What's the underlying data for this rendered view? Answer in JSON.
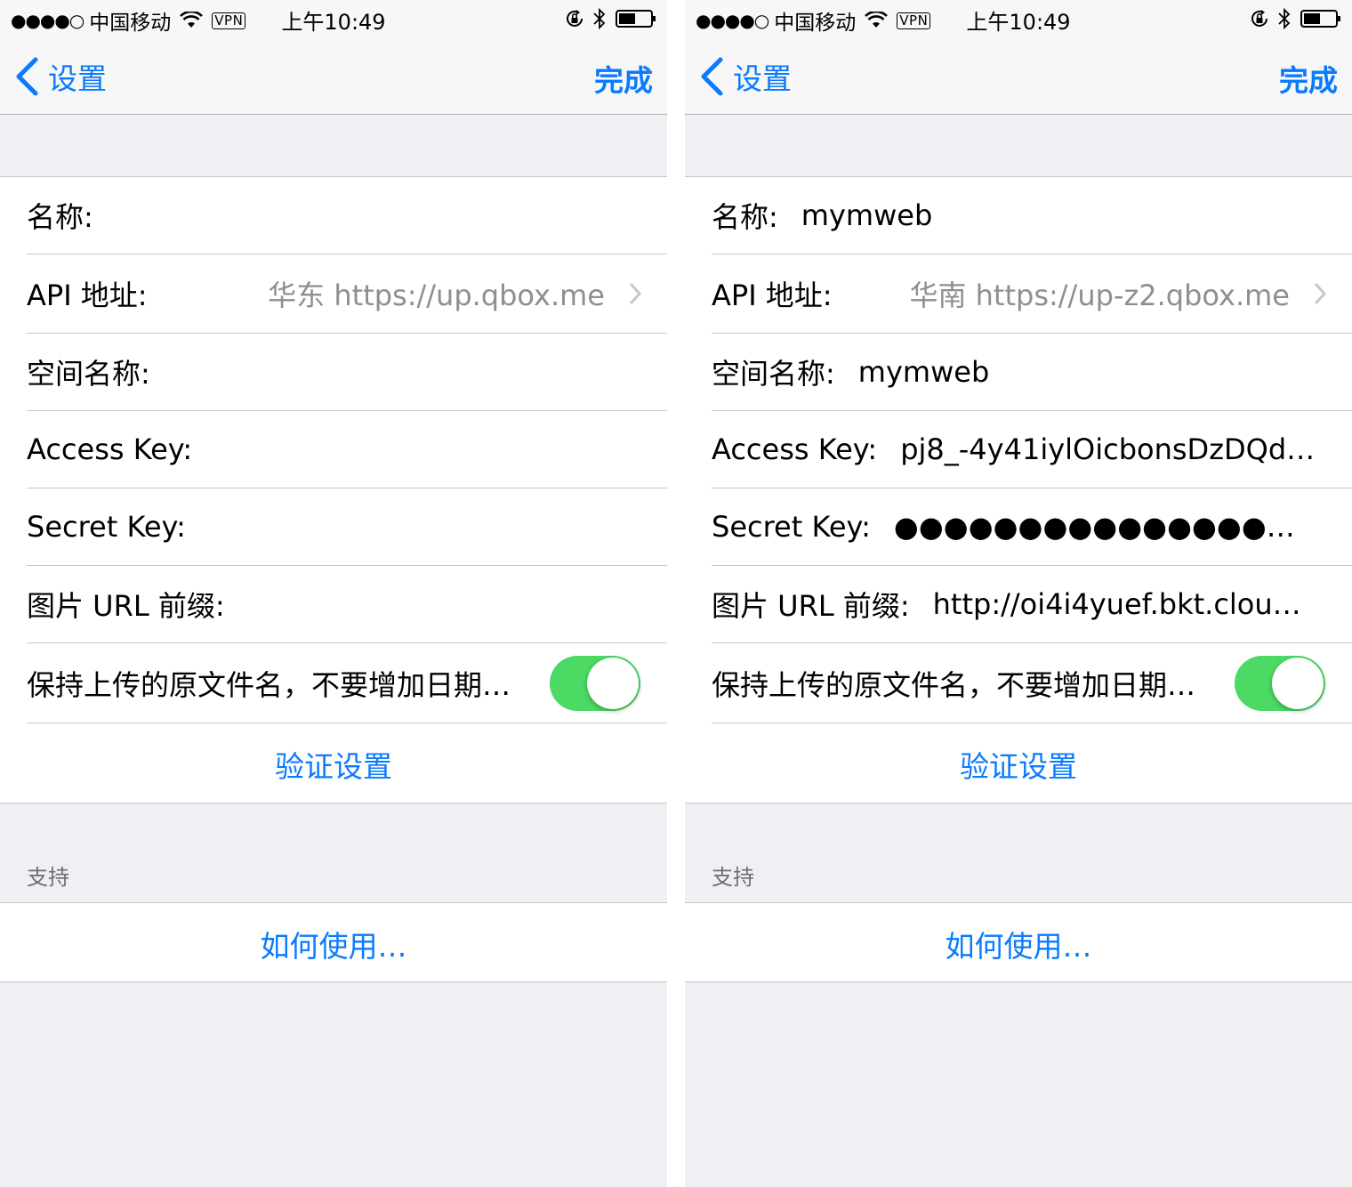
{
  "colors": {
    "accent": "#0a7aff",
    "toggle_on": "#4cd964",
    "background": "#efeff4"
  },
  "screens": [
    {
      "status": {
        "signal": "●●●●○",
        "carrier": "中国移动",
        "vpn": "VPN",
        "time": "上午10:49"
      },
      "nav": {
        "back": "设置",
        "done": "完成"
      },
      "form": {
        "name_label": "名称:",
        "name_value": "",
        "api_label": "API 地址:",
        "api_value": "华东 https://up.qbox.me",
        "bucket_label": "空间名称:",
        "bucket_value": "",
        "access_label": "Access Key:",
        "access_value": "",
        "secret_label": "Secret Key:",
        "secret_value": "",
        "prefix_label": "图片 URL 前缀:",
        "prefix_value": "",
        "keep_name_label": "保持上传的原文件名，不要增加日期…",
        "keep_name_on": true,
        "verify": "验证设置"
      },
      "support": {
        "header": "支持",
        "how_to": "如何使用…"
      }
    },
    {
      "status": {
        "signal": "●●●●○",
        "carrier": "中国移动",
        "vpn": "VPN",
        "time": "上午10:49"
      },
      "nav": {
        "back": "设置",
        "done": "完成"
      },
      "form": {
        "name_label": "名称:",
        "name_value": "mymweb",
        "api_label": "API 地址:",
        "api_value": "华南 https://up-z2.qbox.me",
        "bucket_label": "空间名称:",
        "bucket_value": "mymweb",
        "access_label": "Access Key:",
        "access_value": "pj8_-4y41iylOicbonsDzDQdG...",
        "secret_label": "Secret Key:",
        "secret_value": "●●●●●●●●●●●●●●●●●●●●●●●...",
        "prefix_label": "图片 URL 前缀:",
        "prefix_value": "http://oi4i4yuef.bkt.cloud...",
        "keep_name_label": "保持上传的原文件名，不要增加日期…",
        "keep_name_on": true,
        "verify": "验证设置"
      },
      "support": {
        "header": "支持",
        "how_to": "如何使用…"
      }
    }
  ]
}
